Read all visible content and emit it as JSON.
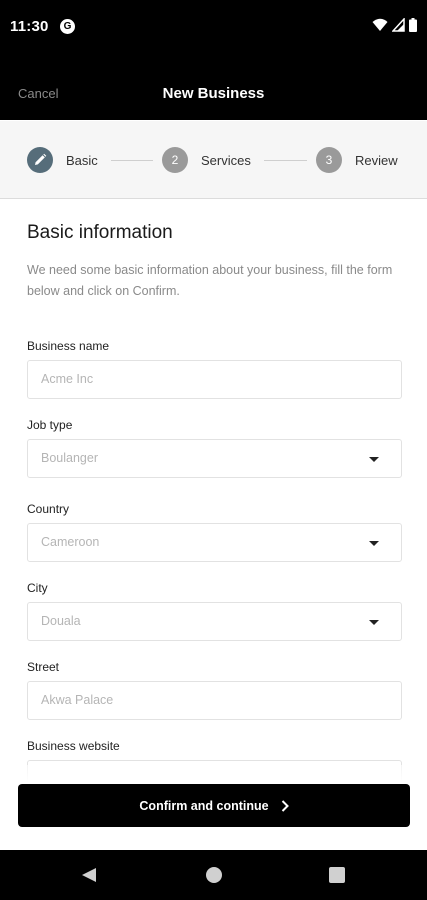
{
  "status_bar": {
    "time": "11:30",
    "app_icon": "G",
    "icons": [
      "wifi-icon",
      "signal-icon",
      "battery-icon"
    ]
  },
  "app_bar": {
    "cancel_label": "Cancel",
    "title": "New Business"
  },
  "stepper": {
    "steps": [
      {
        "number": "",
        "label": "Basic",
        "state": "active",
        "icon": "pencil-icon"
      },
      {
        "number": "2",
        "label": "Services",
        "state": "upcoming"
      },
      {
        "number": "3",
        "label": "Review",
        "state": "upcoming"
      }
    ]
  },
  "form": {
    "title": "Basic information",
    "description": "We need some basic information about your business, fill the form below and click on Confirm.",
    "fields": [
      {
        "label": "Business name",
        "placeholder": "Acme Inc",
        "type": "text"
      },
      {
        "label": "Job type",
        "placeholder": "Boulanger",
        "type": "select"
      },
      {
        "label": "Country",
        "placeholder": "Cameroon",
        "type": "select"
      },
      {
        "label": "City",
        "placeholder": "Douala",
        "type": "select"
      },
      {
        "label": "Street",
        "placeholder": "Akwa Palace",
        "type": "text"
      },
      {
        "label": "Business website",
        "placeholder": "",
        "type": "text"
      }
    ]
  },
  "confirm_button": {
    "label": "Confirm and continue",
    "icon": "chevron-right-icon"
  },
  "nav_bar": {
    "icons": [
      "back-icon",
      "home-icon",
      "recents-icon"
    ]
  },
  "colors": {
    "active_step": "#566d7a",
    "inactive_step": "#9a9a9a",
    "app_bar": "#000000",
    "placeholder": "#b5b5b5"
  }
}
